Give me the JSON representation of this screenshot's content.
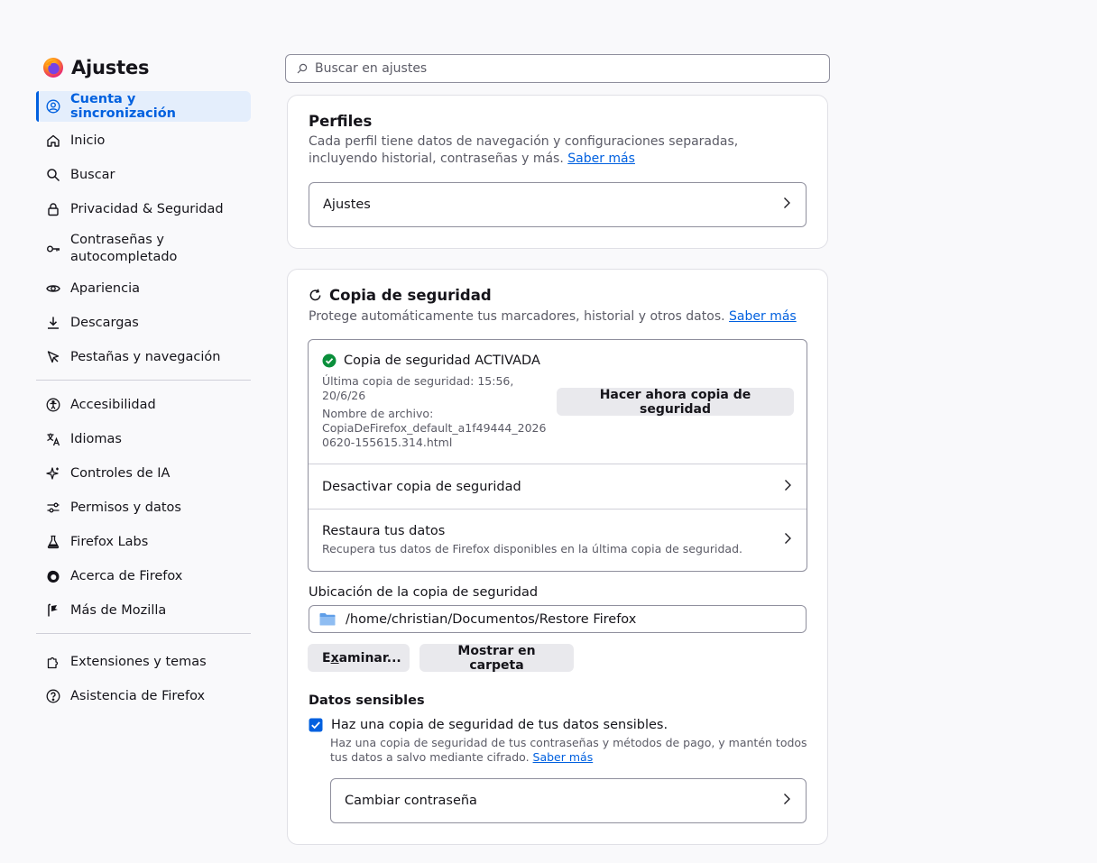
{
  "brand": {
    "title": "Ajustes",
    "icon": "firefox-logo"
  },
  "search": {
    "placeholder": "Buscar en ajustes"
  },
  "sidebar": {
    "items": [
      {
        "label": "Cuenta y sincronización",
        "icon": "account-icon",
        "active": true
      },
      {
        "label": "Inicio",
        "icon": "home-icon"
      },
      {
        "label": "Buscar",
        "icon": "search-icon"
      },
      {
        "label": "Privacidad & Seguridad",
        "icon": "lock-icon"
      },
      {
        "label": "Contraseñas y autocompletado",
        "icon": "key-icon"
      },
      {
        "label": "Apariencia",
        "icon": "eye-icon"
      },
      {
        "label": "Descargas",
        "icon": "download-icon"
      },
      {
        "label": "Pestañas y navegación",
        "icon": "cursor-icon"
      }
    ],
    "items2": [
      {
        "label": "Accesibilidad",
        "icon": "accessibility-icon"
      },
      {
        "label": "Idiomas",
        "icon": "translate-icon"
      },
      {
        "label": "Controles de IA",
        "icon": "sparkle-icon"
      },
      {
        "label": "Permisos y datos",
        "icon": "sliders-icon"
      },
      {
        "label": "Firefox Labs",
        "icon": "flask-icon"
      },
      {
        "label": "Acerca de Firefox",
        "icon": "firefox-icon"
      },
      {
        "label": "Más de Mozilla",
        "icon": "mozilla-icon"
      }
    ],
    "items3": [
      {
        "label": "Extensiones y temas",
        "icon": "puzzle-icon"
      },
      {
        "label": "Asistencia de Firefox",
        "icon": "help-icon"
      }
    ]
  },
  "profiles": {
    "title": "Perfiles",
    "desc": "Cada perfil tiene datos de navegación y configuraciones separadas, incluyendo historial, contraseñas y más.",
    "learn_more": "Saber más",
    "settings_row": "Ajustes"
  },
  "backup": {
    "title": "Copia de seguridad",
    "desc": "Protege automáticamente tus marcadores, historial y otros datos.",
    "learn_more": "Saber más",
    "status_title": "Copia de seguridad ACTIVADA",
    "last_backup": "Última copia de seguridad: 15:56, 20/6/26",
    "filename_label": "Nombre de archivo:",
    "filename": "CopiaDeFirefox_default_a1f49444_20260620-155615.314.html",
    "backup_now_button": "Hacer ahora copia de seguridad",
    "disable_row": "Desactivar copia de seguridad",
    "restore_title": "Restaura tus datos",
    "restore_desc": "Recupera tus datos de Firefox disponibles en la última copia de seguridad.",
    "location_label": "Ubicación de la copia de seguridad",
    "location_path": "/home/christian/Documentos/Restore Firefox",
    "browse_button_pre": "E",
    "browse_button_key": "x",
    "browse_button_post": "aminar...",
    "show_folder_button": "Mostrar en carpeta",
    "sensitive_heading": "Datos sensibles",
    "sensitive_checkbox_label": "Haz una copia de seguridad de tus datos sensibles.",
    "sensitive_checked": true,
    "sensitive_desc": "Haz una copia de seguridad de tus contraseñas y métodos de pago, y mantén todos tus datos a salvo mediante cifrado.",
    "sensitive_learn_more": "Saber más",
    "change_password_row": "Cambiar contraseña"
  },
  "colors": {
    "accent": "#0060df",
    "success": "#2ac3a2",
    "background": "#f9f9fb"
  }
}
